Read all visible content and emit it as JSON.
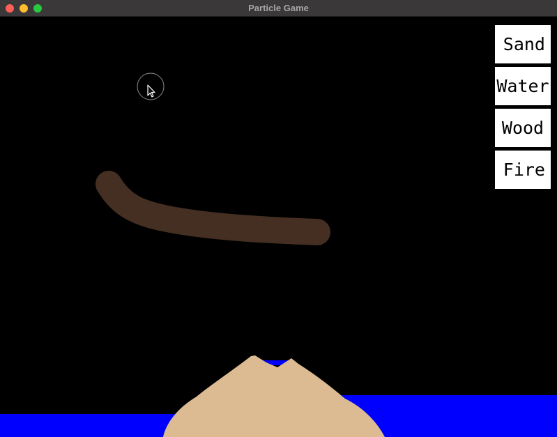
{
  "window": {
    "title": "Particle Game",
    "controls": {
      "close_color": "#fe5f57",
      "minimize_color": "#febc2e",
      "maximize_color": "#28c840"
    }
  },
  "materials": [
    {
      "label": "Sand",
      "color": "#dcba92"
    },
    {
      "label": "Water",
      "color": "#0000ff"
    },
    {
      "label": "Wood",
      "color": "#442f22"
    },
    {
      "label": "Fire",
      "color": "#ff4500"
    }
  ],
  "scene": {
    "background_color": "#000000",
    "cursor_icon": "arrow-cursor-icon"
  }
}
